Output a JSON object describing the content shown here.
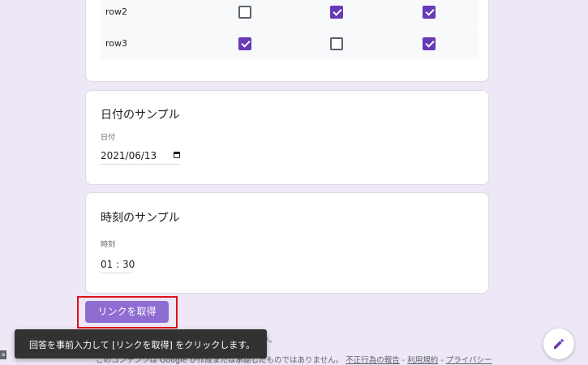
{
  "grid": {
    "rows": [
      {
        "label": "row2",
        "checks": [
          false,
          true,
          true
        ]
      },
      {
        "label": "row3",
        "checks": [
          true,
          false,
          true
        ]
      }
    ]
  },
  "date_question": {
    "title": "日付のサンプル",
    "sub_label": "日付",
    "value": "2021/06/13",
    "icon": "calendar-icon"
  },
  "time_question": {
    "title": "時刻のサンプル",
    "sub_label": "時刻",
    "value": "01 : 30"
  },
  "get_link_button": "リンクを取得",
  "toast": "回答を事前入力して [リンクを取得] をクリックします。",
  "footer": {
    "partial_top": "い。",
    "prefix": "このコンテンツは Google が作成または承認したものではありません。",
    "abuse_link": "不正行為の報告",
    "sep1": " - ",
    "terms_link": "利用規約",
    "sep2": " - ",
    "privacy_link": "プライバシー"
  },
  "left_edge_label": "a",
  "colors": {
    "accent": "#673ab7",
    "button": "#8e6cd2",
    "background": "#ede7f6",
    "highlight": "#e0101a"
  },
  "edit_fab_icon": "pencil-icon"
}
